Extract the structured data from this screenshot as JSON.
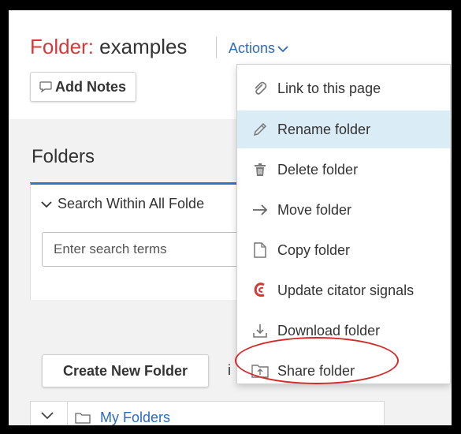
{
  "header": {
    "title_prefix": "Folder:",
    "title_name": "examples",
    "actions_label": "Actions",
    "add_notes_label": "Add Notes"
  },
  "sidebar": {
    "heading": "Folders",
    "search_toggle_label": "Search Within All Folde",
    "search_placeholder": "Enter search terms",
    "create_button_label": "Create New Folder",
    "stray_text": "i",
    "tree": [
      {
        "label": "My Folders",
        "icon": "folder-icon"
      }
    ]
  },
  "actions_menu": {
    "items": [
      {
        "label": "Link to this page",
        "icon": "paperclip-icon",
        "highlighted": false
      },
      {
        "label": "Rename folder",
        "icon": "pencil-icon",
        "highlighted": true
      },
      {
        "label": "Delete folder",
        "icon": "trash-icon",
        "highlighted": false
      },
      {
        "label": "Move folder",
        "icon": "arrow-right-icon",
        "highlighted": false
      },
      {
        "label": "Copy folder",
        "icon": "document-icon",
        "highlighted": false
      },
      {
        "label": "Update citator signals",
        "icon": "citator-icon",
        "highlighted": false
      },
      {
        "label": "Download folder",
        "icon": "download-icon",
        "highlighted": false
      },
      {
        "label": "Share folder",
        "icon": "share-folder-icon",
        "highlighted": false
      }
    ],
    "annotation_circled_item": "Share folder"
  },
  "colors": {
    "title_accent": "#d43a3a",
    "link_blue": "#2a6bc4",
    "highlight_bg": "#daecf6",
    "panel_border": "#2b77c9",
    "annotation_red": "#d42a2a"
  }
}
